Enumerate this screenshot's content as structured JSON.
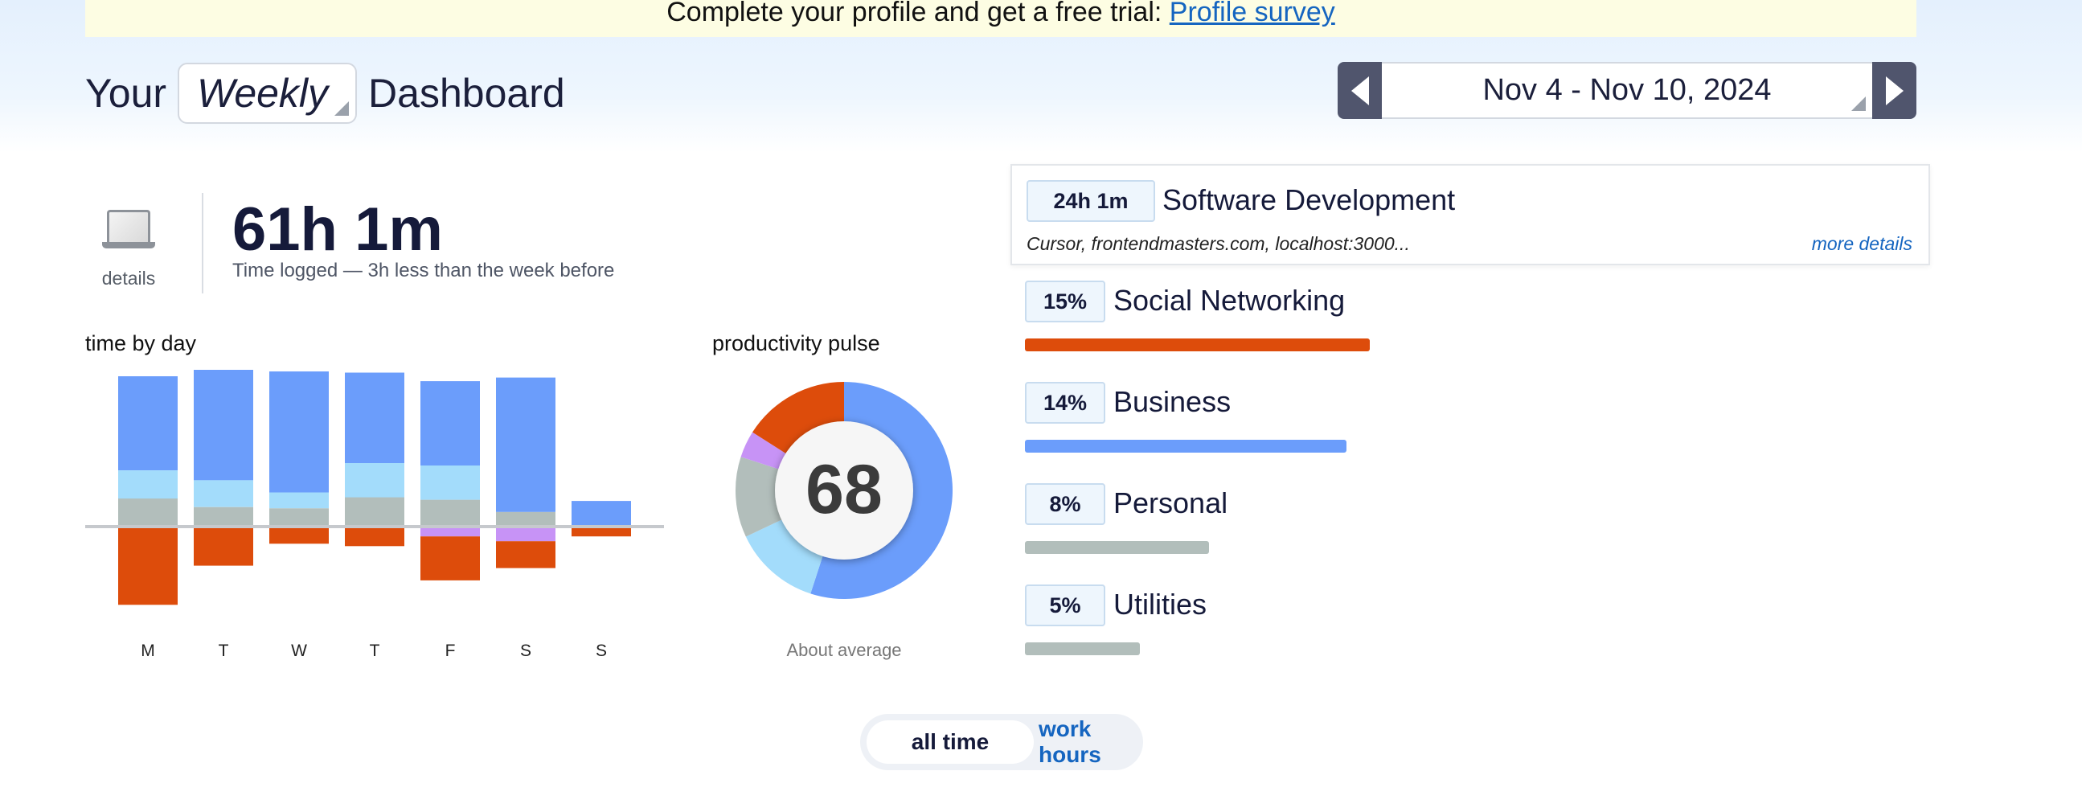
{
  "banner": {
    "text": "Complete your profile and get a free trial:",
    "link": "Profile survey"
  },
  "header": {
    "title_prefix": "Your",
    "period": "Weekly",
    "title_suffix": "Dashboard",
    "date_range": "Nov 4 - Nov 10, 2024"
  },
  "summary": {
    "details_label": "details",
    "total": "61h 1m",
    "subtitle": "Time logged — 3h less than the week before"
  },
  "time_by_day": {
    "label": "time by day"
  },
  "productivity": {
    "label": "productivity pulse",
    "score": "68",
    "caption": "About average"
  },
  "categories": [
    {
      "value": "24h 1m",
      "name": "Software Development",
      "apps": "Cursor, frontendmasters.com, localhost:3000...",
      "link": "more details"
    },
    {
      "value": "15%",
      "name": "Social Networking",
      "bar_fraction": 0.15,
      "color": "#dd4c0b"
    },
    {
      "value": "14%",
      "name": "Business",
      "bar_fraction": 0.14,
      "color": "#6b9dfb"
    },
    {
      "value": "8%",
      "name": "Personal",
      "bar_fraction": 0.08,
      "color": "#b2bebb"
    },
    {
      "value": "5%",
      "name": "Utilities",
      "bar_fraction": 0.05,
      "color": "#b2bebb"
    }
  ],
  "toggle": {
    "active": "all time",
    "inactive": "work hours"
  },
  "colors": {
    "productive": "#6b9dfb",
    "light_productive": "#a3dcfb",
    "neutral": "#b2bebb",
    "distracting": "#c793f6",
    "very_distracting": "#dd4c0b"
  },
  "chart_data": [
    {
      "type": "bar",
      "title": "time by day",
      "categories": [
        "M",
        "T",
        "W",
        "T",
        "F",
        "S",
        "S"
      ],
      "series": [
        {
          "color": "#b2bebb",
          "values": [
            2.3,
            1.6,
            1.5,
            2.4,
            2.2,
            1.2,
            0
          ]
        },
        {
          "color": "#a3dcfb",
          "values": [
            2.3,
            2.2,
            1.3,
            2.8,
            2.8,
            0,
            0
          ]
        },
        {
          "color": "#6b9dfb",
          "values": [
            7.7,
            9.9,
            9.9,
            7.4,
            6.9,
            11.0,
            2.1
          ]
        },
        {
          "color": "#c793f6",
          "values": [
            0,
            0,
            0,
            0,
            -0.8,
            -1.2,
            0
          ]
        },
        {
          "color": "#dd4c0b",
          "values": [
            -6.4,
            -3.2,
            -1.4,
            -1.6,
            -3.6,
            -2.2,
            -0.8
          ]
        }
      ]
    },
    {
      "type": "pie",
      "title": "productivity pulse",
      "slices": [
        {
          "color": "#6b9dfb",
          "value": 0.55
        },
        {
          "color": "#a3dcfb",
          "value": 0.13
        },
        {
          "color": "#b2bebb",
          "value": 0.12
        },
        {
          "color": "#c793f6",
          "value": 0.04
        },
        {
          "color": "#dd4c0b",
          "value": 0.16
        }
      ]
    }
  ]
}
